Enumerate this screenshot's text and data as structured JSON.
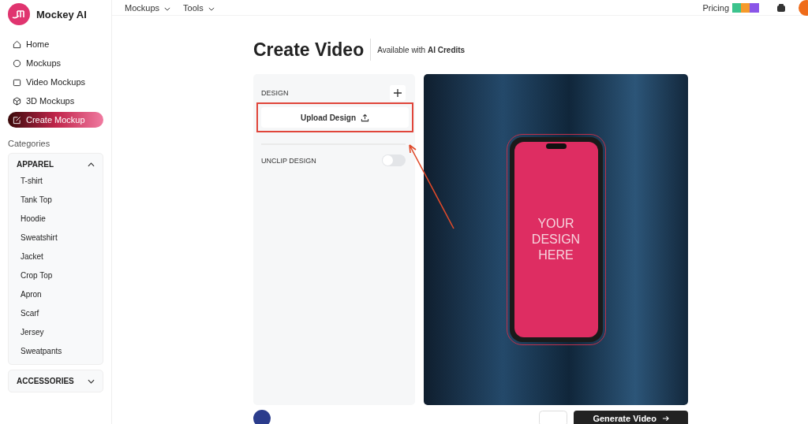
{
  "brand": {
    "name": "Mockey AI"
  },
  "nav": [
    {
      "label": "Home",
      "selected": false
    },
    {
      "label": "Mockups",
      "selected": false
    },
    {
      "label": "Video Mockups",
      "selected": false
    },
    {
      "label": "3D Mockups",
      "selected": false
    },
    {
      "label": "Create Mockup",
      "selected": true
    }
  ],
  "categories_title": "Categories",
  "categories": [
    {
      "label": "APPAREL",
      "expanded": true,
      "items": [
        "T-shirt",
        "Tank Top",
        "Hoodie",
        "Sweatshirt",
        "Jacket",
        "Crop Top",
        "Apron",
        "Scarf",
        "Jersey",
        "Sweatpants"
      ]
    },
    {
      "label": "ACCESSORIES",
      "expanded": false
    }
  ],
  "topbar": {
    "menus": [
      "Mockups",
      "Tools"
    ],
    "pricing": "Pricing"
  },
  "page": {
    "title": "Create Video",
    "subtitle": "Available with **AI Credits**"
  },
  "panel": {
    "design_label": "DESIGN",
    "upload_button": "Upload Design",
    "unclip_label": "UNCLIP DESIGN",
    "unclip_on": false
  },
  "canvas": {
    "design_text": "YOUR\nDESIGN\nHERE"
  },
  "footer": {
    "generate_button": "Generate Video"
  }
}
